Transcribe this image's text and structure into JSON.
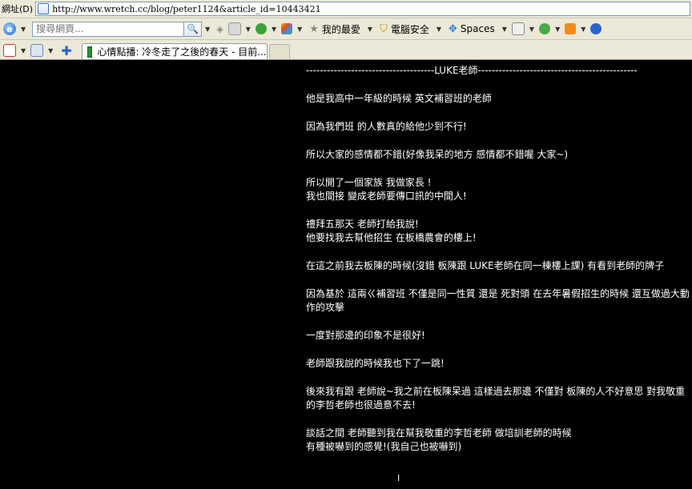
{
  "browser": {
    "address_label": "網址(D)",
    "url": "http://www.wretch.cc/blog/peter1124&article_id=10443421",
    "search_placeholder": "搜尋網頁...",
    "toolbar": {
      "favorites": "我的最愛",
      "security": "電腦安全",
      "spaces": "Spaces"
    },
    "tab_title": "心情點播: 冷冬走了之後的春天 - 目前..."
  },
  "article": {
    "paragraphs": [
      [
        "-------------------------------------LUKE老師----------------------------------------------"
      ],
      [
        "他是我高中一年級的時候 英文補習班的老師"
      ],
      [
        "因為我們班 的人數真的給他少到不行!"
      ],
      [
        "所以大家的感情都不錯(好像我呆的地方 感情都不錯喔 大家~)"
      ],
      [
        "所以開了一個家族 我做家長 !",
        "我也間接 變成老師要傳口訊的中間人!"
      ],
      [
        "禮拜五那天 老師打給我說!",
        "他要找我去幫他招生 在板橋農會的樓上!"
      ],
      [
        "在這之前我去板陳的時候(沒錯 板陳跟 LUKE老師在同一棟樓上課) 有看到老師的牌子"
      ],
      [
        "因為基於 這兩ㄍ補習班 不僅是同一性質 還是 死對頭 在去年暑假招生的時候 還互做過大動作的攻擊"
      ],
      [
        "一度對那邊的印象不是很好!"
      ],
      [
        "老師跟我說的時候我也下了一跳!"
      ],
      [
        "後來我有跟 老師說~我之前在板陳呆過 這樣過去那邊 不僅對 板陳的人不好意思 對我敬重的李哲老師也很過意不去!"
      ],
      [
        "談話之間 老師聽到我在幫我敬重的李哲老師 做培訓老師的時候",
        "有種被嚇到的感覺!(我自己也被嚇到)"
      ]
    ]
  }
}
